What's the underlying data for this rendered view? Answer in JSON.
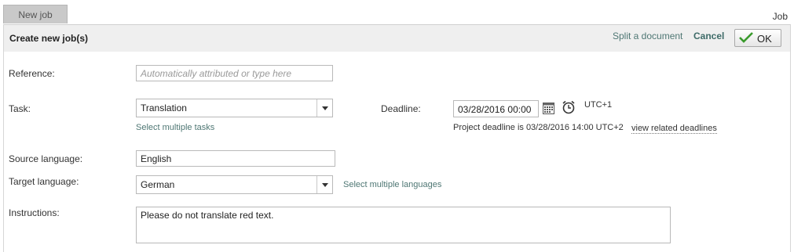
{
  "tab": {
    "label": "New job"
  },
  "breadcrumb": {
    "label": "Job"
  },
  "header": {
    "title": "Create new job(s)",
    "split_label": "Split a document",
    "cancel_label": "Cancel",
    "ok_label": "OK"
  },
  "form": {
    "reference": {
      "label": "Reference:",
      "placeholder": "Automatically attributed or type here"
    },
    "task": {
      "label": "Task:",
      "value": "Translation",
      "multi_link": "Select multiple tasks"
    },
    "deadline": {
      "label": "Deadline:",
      "value": "03/28/2016 00:00",
      "timezone": "UTC+1",
      "project_note": "Project deadline is 03/28/2016 14:00 UTC+2",
      "related_link": "view related deadlines"
    },
    "source_language": {
      "label": "Source language:",
      "value": "English"
    },
    "target_language": {
      "label": "Target language:",
      "value": "German",
      "multi_link": "Select multiple languages"
    },
    "instructions": {
      "label": "Instructions:",
      "value": "Please do not translate red text."
    }
  },
  "icons": {
    "calendar": "calendar-icon",
    "clock": "clock-icon",
    "check": "checkmark-icon",
    "dropdown": "chevron-down-icon"
  },
  "colors": {
    "link": "#4f7774",
    "header_bg": "#efefef",
    "tab_bg": "#c9c9c9",
    "check": "#3a9a2c"
  }
}
